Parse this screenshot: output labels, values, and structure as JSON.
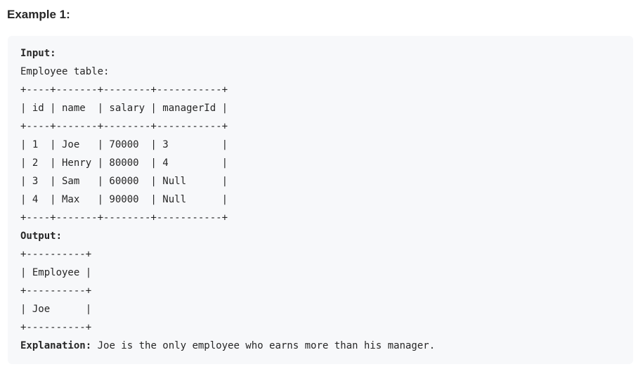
{
  "heading": "Example 1:",
  "example": {
    "input_label": "Input:",
    "table_caption": "Employee table:",
    "input_table": [
      "+----+-------+--------+-----------+",
      "| id | name  | salary | managerId |",
      "+----+-------+--------+-----------+",
      "| 1  | Joe   | 70000  | 3         |",
      "| 2  | Henry | 80000  | 4         |",
      "| 3  | Sam   | 60000  | Null      |",
      "| 4  | Max   | 90000  | Null      |",
      "+----+-------+--------+-----------+"
    ],
    "output_label": "Output:",
    "output_table": [
      "+----------+",
      "| Employee |",
      "+----------+",
      "| Joe      |",
      "+----------+"
    ],
    "explanation_label": "Explanation:",
    "explanation_text": " Joe is the only employee who earns more than his manager."
  }
}
